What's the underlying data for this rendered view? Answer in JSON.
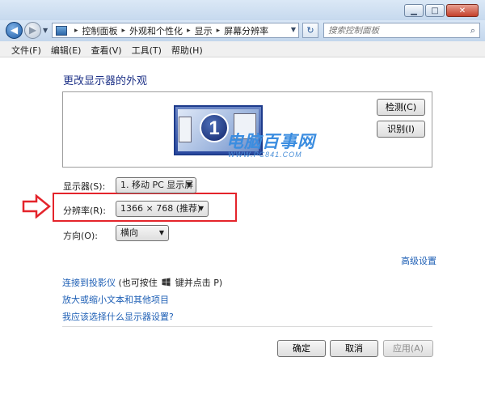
{
  "window": {
    "controls": {
      "minimize": "▁",
      "maximize": "□",
      "close": "✕"
    }
  },
  "address_bar": {
    "crumbs": [
      "控制面板",
      "外观和个性化",
      "显示",
      "屏幕分辨率"
    ],
    "search_placeholder": "搜索控制面板"
  },
  "menu": [
    {
      "label": "文件(F)"
    },
    {
      "label": "编辑(E)"
    },
    {
      "label": "查看(V)"
    },
    {
      "label": "工具(T)"
    },
    {
      "label": "帮助(H)"
    }
  ],
  "page": {
    "title": "更改显示器的外观",
    "monitor_number": "1",
    "detect_button": "检测(C)",
    "identify_button": "识别(I)"
  },
  "watermark": {
    "title": "电脑百事网",
    "subtitle": "WWW.PC841.COM"
  },
  "settings": {
    "display_label": "显示器(S):",
    "display_value": "1. 移动 PC 显示屏",
    "resolution_label": "分辨率(R):",
    "resolution_value": "1366 × 768 (推荐)",
    "orientation_label": "方向(O):",
    "orientation_value": "横向"
  },
  "links": {
    "advanced": "高级设置",
    "projector": "连接到投影仪",
    "projector_hint_a": "(也可按住",
    "projector_hint_b": "键并点击 P)",
    "text_size": "放大或缩小文本和其他项目",
    "which_settings": "我应该选择什么显示器设置?"
  },
  "buttons": {
    "ok": "确定",
    "cancel": "取消",
    "apply": "应用(A)"
  },
  "colors": {
    "highlight_box": "#e4242b",
    "link": "#1e5fb5",
    "title": "#1e3287"
  }
}
